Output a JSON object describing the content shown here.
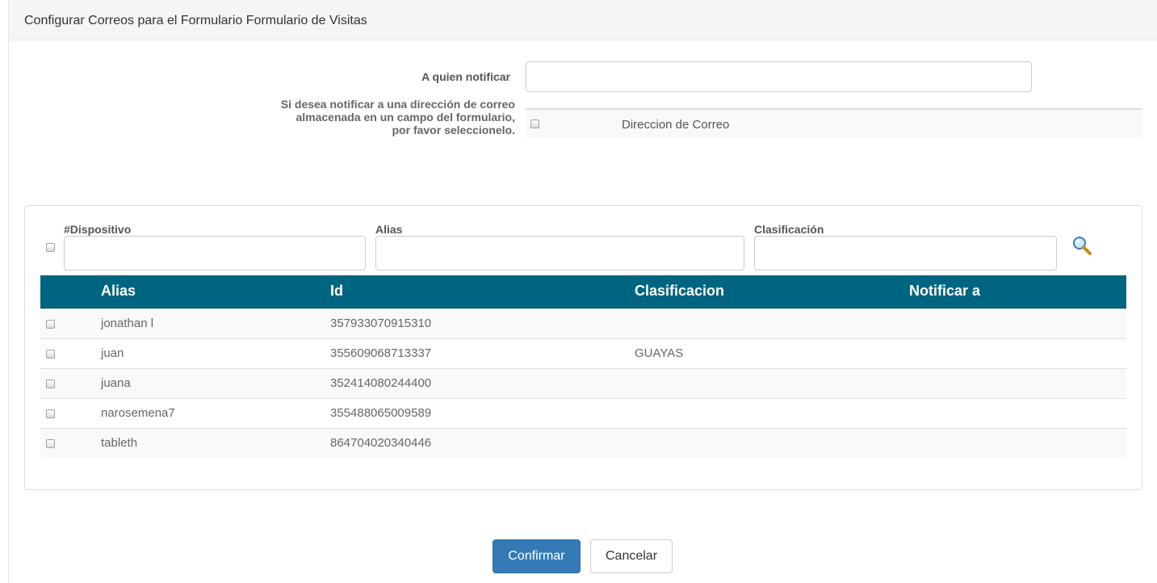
{
  "modal": {
    "title": "Configurar Correos para el Formulario Formulario de Visitas"
  },
  "notify": {
    "label": "A quien notificar",
    "value": "",
    "hint_lines": [
      "Si desea notificar a una dirección de correo",
      "almacenada en un campo del formulario,",
      "por favor seleccionelo."
    ],
    "field_option": "Direccion de Correo"
  },
  "filters": {
    "dispositivo_label": "#Dispositivo",
    "alias_label": "Alias",
    "clasificacion_label": "Clasificación",
    "search_icon": "magnifier-icon"
  },
  "grid": {
    "headers": [
      "Alias",
      "Id",
      "Clasificacion",
      "Notificar a"
    ],
    "header_color": "#006580",
    "rows": [
      {
        "alias": "jonathan l",
        "id": "357933070915310",
        "clasificacion": "",
        "notificar": ""
      },
      {
        "alias": "juan",
        "id": "355609068713337",
        "clasificacion": "GUAYAS",
        "notificar": ""
      },
      {
        "alias": "juana",
        "id": "352414080244400",
        "clasificacion": "",
        "notificar": ""
      },
      {
        "alias": "narosemena7",
        "id": "355488065009589",
        "clasificacion": "",
        "notificar": ""
      },
      {
        "alias": "tableth",
        "id": "864704020340446",
        "clasificacion": "",
        "notificar": ""
      }
    ]
  },
  "buttons": {
    "confirm": "Confirmar",
    "cancel": "Cancelar",
    "primary_color": "#337ab7"
  }
}
